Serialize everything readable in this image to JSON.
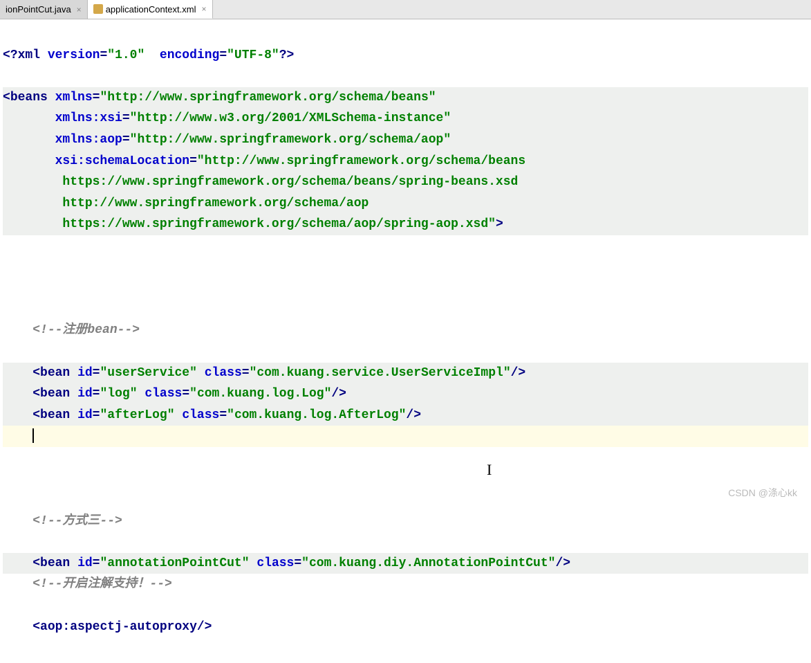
{
  "tabs": [
    {
      "label": "ionPointCut.java",
      "active": false
    },
    {
      "label": "applicationContext.xml",
      "active": true
    }
  ],
  "code": {
    "xml_decl": {
      "open": "<?",
      "xml": "xml",
      "version_attr": "version",
      "version_val": "\"1.0\"",
      "encoding_attr": "encoding",
      "encoding_val": "\"UTF-8\"",
      "close": "?>"
    },
    "beans_open": {
      "open": "<",
      "name": "beans",
      "xmlns": "xmlns",
      "xmlns_val": "\"http://www.springframework.org/schema/beans\"",
      "xmlns_xsi": "xmlns:xsi",
      "xmlns_xsi_val": "\"http://www.w3.org/2001/XMLSchema-instance\"",
      "xmlns_aop": "xmlns:aop",
      "xmlns_aop_val": "\"http://www.springframework.org/schema/aop\"",
      "xsi_loc": "xsi:schemaLocation",
      "xsi_loc_val1": "\"http://www.springframework.org/schema/beans",
      "xsi_loc_val2": "https://www.springframework.org/schema/beans/spring-beans.xsd",
      "xsi_loc_val3": "http://www.springframework.org/schema/aop",
      "xsi_loc_val4": "https://www.springframework.org/schema/aop/spring-aop.xsd\"",
      "close": ">"
    },
    "comment1": "<!--注册bean-->",
    "bean1": {
      "open": "<",
      "name": "bean",
      "id_attr": "id",
      "id_val": "\"userService\"",
      "class_attr": "class",
      "class_val": "\"com.kuang.service.UserServiceImpl\"",
      "close": "/>"
    },
    "bean2": {
      "open": "<",
      "name": "bean",
      "id_attr": "id",
      "id_val": "\"log\"",
      "class_attr": "class",
      "class_val": "\"com.kuang.log.Log\"",
      "close": "/>"
    },
    "bean3": {
      "open": "<",
      "name": "bean",
      "id_attr": "id",
      "id_val": "\"afterLog\"",
      "class_attr": "class",
      "class_val": "\"com.kuang.log.AfterLog\"",
      "close": "/>"
    },
    "comment2": "<!--方式三-->",
    "bean4": {
      "open": "<",
      "name": "bean",
      "id_attr": "id",
      "id_val": "\"annotationPointCut\"",
      "class_attr": "class",
      "class_val": "\"com.kuang.diy.AnnotationPointCut\"",
      "close": "/>"
    },
    "comment3": "<!--开启注解支持！-->",
    "autoproxy": {
      "open": "<",
      "name": "aop:aspectj-autoproxy",
      "close": "/>"
    }
  },
  "watermark": "CSDN @涤心kk"
}
